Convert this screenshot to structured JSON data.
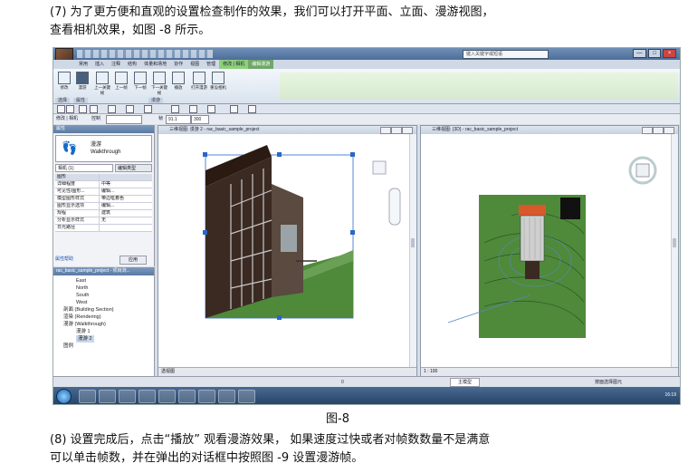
{
  "doc": {
    "para1_line1": "(7)  为了更方便和直观的设置检查制作的效果，我们可以打开平面、立面、漫游视图，",
    "para1_line2": "查看相机效果，如图    -8 所示。",
    "caption": "图-8",
    "para2_line1": "(8)  设置完成后，点击“播放”  观看漫游效果，   如果速度过快或者对帧数数量不是满意",
    "para2_line2": "可以单击帧数，并在弹出的对话框中按照图        -9 设置漫游帧。"
  },
  "screenshot": {
    "search_placeholder": "键入关键字或短语",
    "window_buttons": [
      "—",
      "□",
      "×"
    ],
    "ribbon_tabs": [
      "常用",
      "插入",
      "注释",
      "结构",
      "体量和场地",
      "协作",
      "视图",
      "管理",
      "修改 | 相机",
      "编辑漫游"
    ],
    "ribbon_buttons": [
      {
        "label": "修改",
        "icon": "modify-icon"
      },
      {
        "label": "漫游",
        "icon": "walkthrough-icon"
      },
      {
        "label": "上一关键帧",
        "icon": "prev-key-frame-icon"
      },
      {
        "label": "上一帧",
        "icon": "prev-frame-icon"
      },
      {
        "label": "下一帧",
        "icon": "next-frame-icon"
      },
      {
        "label": "下一关键帧",
        "icon": "next-key-frame-icon"
      },
      {
        "label": "播放",
        "icon": "play-icon"
      },
      {
        "label": "打开漫游",
        "icon": "open-walkthrough-icon"
      },
      {
        "label": "重设相机",
        "icon": "reset-camera-icon"
      }
    ],
    "ribbon_panels": [
      "选择",
      "属性",
      "漫游"
    ],
    "options_bar": {
      "label": "修改 | 相机",
      "control": "控制",
      "frame_label": "帧",
      "frame_value": "91.1",
      "total_frames": "300"
    },
    "properties": {
      "header": "属性",
      "type_name_cn": "漫游",
      "type_name_en": "Walkthrough",
      "selector": "相机 (1)",
      "edit_type": "编辑类型",
      "group": "图形",
      "rows": [
        {
          "k": "详细程度",
          "v": "中等"
        },
        {
          "k": "可见性/图形...",
          "v": "编辑..."
        },
        {
          "k": "模型图形样式",
          "v": "带边框着色"
        },
        {
          "k": "图形显示选项",
          "v": "编辑..."
        },
        {
          "k": "规程",
          "v": "建筑"
        },
        {
          "k": "分析显示样式",
          "v": "无"
        },
        {
          "k": "日光路径",
          "v": ""
        }
      ],
      "help_link": "属性帮助",
      "apply": "应用"
    },
    "browser": {
      "header": "rac_basic_sample_project - 项目浏...",
      "items": [
        {
          "text": "East",
          "indent": 3
        },
        {
          "text": "North",
          "indent": 3
        },
        {
          "text": "South",
          "indent": 3
        },
        {
          "text": "West",
          "indent": 3
        },
        {
          "text": "剖面 (Building Section)",
          "indent": 1
        },
        {
          "text": "渲染 (Rendering)",
          "indent": 1
        },
        {
          "text": "漫游 (Walkthrough)",
          "indent": 1
        },
        {
          "text": "漫游 1",
          "indent": 3
        },
        {
          "text": "漫游 2",
          "indent": 3,
          "selected": true
        },
        {
          "text": "图例",
          "indent": 1
        }
      ]
    },
    "view_left": {
      "title": "三维视图: 漫游 2 - rac_basic_sample_project",
      "footer": "透视图"
    },
    "view_right": {
      "title": "三维视图: {3D} - rac_basic_sample_project",
      "footer": "1 : 100"
    },
    "status": {
      "zoom": "0",
      "model": "主模型",
      "filter_label": "按面选择图元"
    },
    "tray": {
      "time": "16:19"
    }
  }
}
